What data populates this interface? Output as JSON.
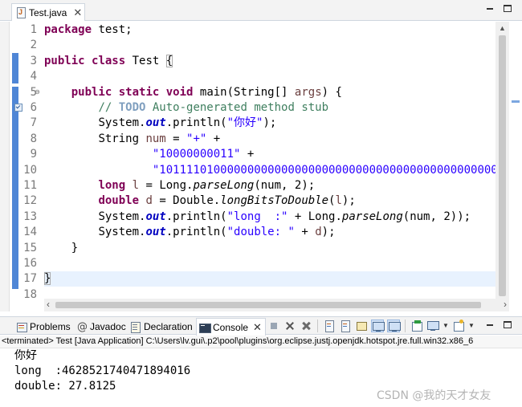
{
  "editor": {
    "tab_label": "Test.java",
    "line_numbers": [
      "1",
      "2",
      "3",
      "4",
      "5",
      "6",
      "7",
      "8",
      "9",
      "10",
      "11",
      "12",
      "13",
      "14",
      "15",
      "16",
      "17",
      "18"
    ],
    "code": {
      "l1_kw": "package",
      "l1_rest": " test;",
      "l3_kw1": "public",
      "l3_kw2": "class",
      "l3_name": " Test ",
      "l3_brace": "{",
      "l5_indent": "    ",
      "l5_kw1": "public",
      "l5_kw2": "static",
      "l5_kw3": "void",
      "l5_mid": " main(String[] ",
      "l5_param": "args",
      "l5_end": ") {",
      "l6_indent": "        ",
      "l6_slashes": "// ",
      "l6_todo": "TODO",
      "l6_rest": " Auto-generated method stub",
      "l7_indent": "        ",
      "l7_a": "System.",
      "l7_out": "out",
      "l7_b": ".println(",
      "l7_str": "\"你好\"",
      "l7_c": ");",
      "l8_indent": "        ",
      "l8_a": "String ",
      "l8_var": "num",
      "l8_b": " = ",
      "l8_str": "\"+\"",
      "l8_c": " +",
      "l9_indent": "                ",
      "l9_str": "\"10000000011\"",
      "l9_c": " +",
      "l10_indent": "                ",
      "l10_str": "\"101111010000000000000000000000000000000000000000000",
      "l11_indent": "        ",
      "l11_kw": "long",
      "l11_sp": " ",
      "l11_var": "l",
      "l11_b": " = Long.",
      "l11_method": "parseLong",
      "l11_c": "(num, 2);",
      "l12_indent": "        ",
      "l12_kw": "double",
      "l12_sp": " ",
      "l12_var": "d",
      "l12_b": " = Double.",
      "l12_method": "longBitsToDouble",
      "l12_c": "(",
      "l12_arg": "l",
      "l12_d": ");",
      "l13_indent": "        ",
      "l13_a": "System.",
      "l13_out": "out",
      "l13_b": ".println(",
      "l13_str": "\"long  :\"",
      "l13_c": " + Long.",
      "l13_method": "parseLong",
      "l13_d": "(num, 2));",
      "l14_indent": "        ",
      "l14_a": "System.",
      "l14_out": "out",
      "l14_b": ".println(",
      "l14_str": "\"double: \"",
      "l14_c": " + ",
      "l14_var": "d",
      "l14_d": ");",
      "l15_indent": "    ",
      "l15_brace": "}",
      "l17_brace": "}"
    }
  },
  "panel": {
    "tabs": {
      "problems": "Problems",
      "javadoc": "Javadoc",
      "declaration": "Declaration",
      "console": "Console"
    },
    "javadoc_glyph": "@",
    "console_header": "<terminated> Test [Java Application] C:\\Users\\lv.gui\\.p2\\pool\\plugins\\org.eclipse.justj.openjdk.hotspot.jre.full.win32.x86_6",
    "output": [
      "你好",
      "long  :4628521740471894016",
      "double: 27.8125"
    ]
  },
  "watermark": "CSDN @我的天才女友",
  "colors": {
    "keyword": "#7f0055",
    "string": "#2a00ff",
    "comment": "#3f7f5f",
    "static_field": "#0000c0",
    "current_line": "#e8f2fe"
  },
  "icons": {
    "editor_tab": "java-file-icon",
    "problems": "problems-icon",
    "javadoc": "javadoc-at-icon",
    "declaration": "declaration-icon",
    "console": "console-icon"
  }
}
